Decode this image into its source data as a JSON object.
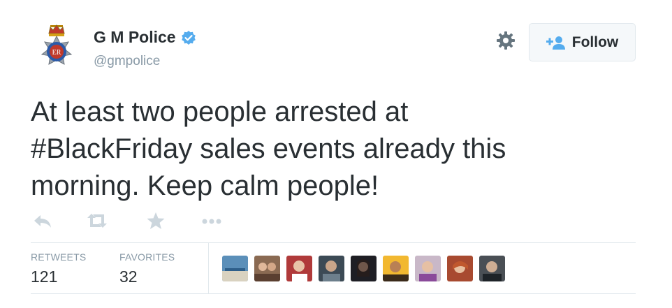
{
  "author": {
    "name": "G M Police",
    "handle": "@gmpolice",
    "verified": true,
    "avatar_icon": "police-badge-icon",
    "badge_text": "ER"
  },
  "header": {
    "settings_icon": "gear-icon",
    "follow_label": "Follow",
    "follow_icon": "add-user-icon"
  },
  "tweet": {
    "text": "At least two people arrested at\n#BlackFriday sales events already this\nmorning. Keep calm people!"
  },
  "actions": {
    "reply_icon": "reply-icon",
    "retweet_icon": "retweet-icon",
    "favorite_icon": "star-icon",
    "more_icon": "more-icon"
  },
  "stats": {
    "retweets_label": "RETWEETS",
    "retweets_value": "121",
    "favorites_label": "FAVORITES",
    "favorites_value": "32"
  },
  "colors": {
    "text": "#292f33",
    "muted": "#8899a6",
    "verified_blue": "#55acee",
    "border": "#e1e8ed",
    "action_icon": "#ccd6dd"
  },
  "retweeter_avatars_count": 9
}
